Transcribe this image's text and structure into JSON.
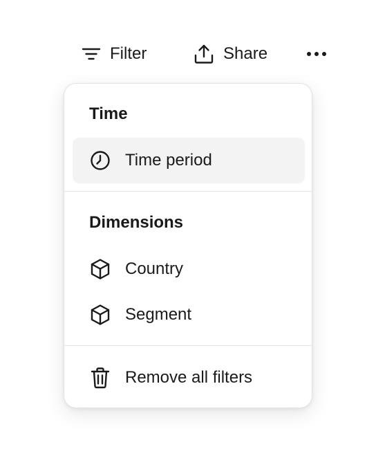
{
  "toolbar": {
    "filter_label": "Filter",
    "share_label": "Share",
    "more_icon": "more-horizontal-icon"
  },
  "menu": {
    "sections": [
      {
        "title": "Time",
        "items": [
          {
            "label": "Time period",
            "icon": "clock-icon",
            "active": true
          }
        ]
      },
      {
        "title": "Dimensions",
        "items": [
          {
            "label": "Country",
            "icon": "cube-icon",
            "active": false
          },
          {
            "label": "Segment",
            "icon": "cube-icon",
            "active": false
          }
        ]
      }
    ],
    "footer": {
      "label": "Remove all filters",
      "icon": "trash-icon"
    }
  },
  "colors": {
    "text": "#1a1a1a",
    "active_bg": "#f3f3f3",
    "border": "#e3e3e3"
  }
}
